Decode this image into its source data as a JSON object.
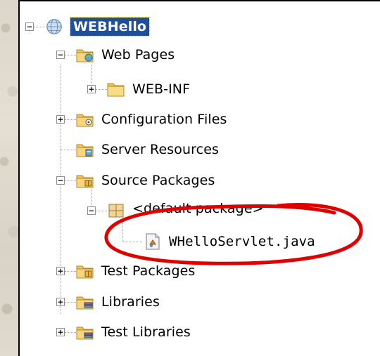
{
  "project": {
    "label": "WEBHello",
    "icon": "globe-icon"
  },
  "tree": {
    "web_pages": {
      "label": "Web Pages",
      "icon": "web-folder-icon"
    },
    "web_inf": {
      "label": "WEB-INF",
      "icon": "folder-icon"
    },
    "config_files": {
      "label": "Configuration Files",
      "icon": "config-folder-icon"
    },
    "server_resources": {
      "label": "Server Resources",
      "icon": "server-folder-icon"
    },
    "source_packages": {
      "label": "Source Packages",
      "icon": "source-folder-icon"
    },
    "default_package": {
      "label": "<default package>",
      "icon": "package-icon"
    },
    "servlet_file": {
      "label": "WHelloServlet.java",
      "icon": "java-file-icon"
    },
    "test_packages": {
      "label": "Test Packages",
      "icon": "test-folder-icon"
    },
    "libraries": {
      "label": "Libraries",
      "icon": "library-folder-icon"
    },
    "test_libraries": {
      "label": "Test Libraries",
      "icon": "library-folder-icon"
    }
  },
  "expander_symbols": {
    "collapse": "−",
    "expand": "+"
  },
  "annotation": {
    "color": "#e00000"
  }
}
